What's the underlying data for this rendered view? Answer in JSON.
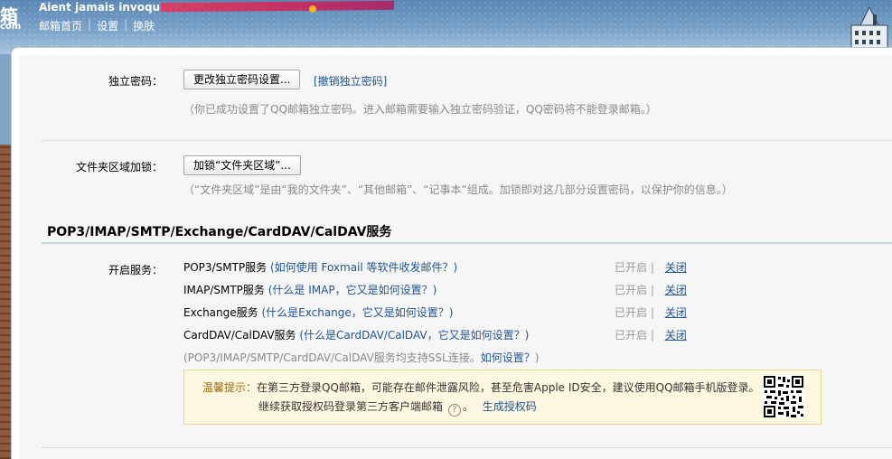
{
  "header": {
    "logo_text": "箱",
    "logo_sub": "com",
    "account_name": "Aient jamais invoqu",
    "links": [
      "邮箱首页",
      "设置",
      "换肤"
    ]
  },
  "independent_password": {
    "label": "独立密码：",
    "change_button": "更改独立密码设置...",
    "revoke_link": "[撤销独立密码]",
    "hint": "（你已成功设置了QQ邮箱独立密码。进入邮箱需要输入独立密码验证，QQ密码将不能登录邮箱。）"
  },
  "folder_lock": {
    "label": "文件夹区域加锁：",
    "lock_button": "加锁“文件夹区域”...",
    "hint": "（“文件夹区域”是由“我的文件夹”、“其他邮箱”、“记事本”组成。加锁即对这几部分设置密码，以保护你的信息。）"
  },
  "services_section": {
    "title": "POP3/IMAP/SMTP/Exchange/CardDAV/CalDAV服务",
    "label": "开启服务：",
    "items": [
      {
        "name": "POP3/SMTP服务",
        "help": "(如何使用 Foxmail 等软件收发邮件？)",
        "status": "已开启",
        "sep": "|",
        "action": "关闭"
      },
      {
        "name": "IMAP/SMTP服务",
        "help": "(什么是 IMAP，它又是如何设置？)",
        "status": "已开启",
        "sep": "|",
        "action": "关闭"
      },
      {
        "name": "Exchange服务",
        "help": "(什么是Exchange，它又是如何设置？)",
        "status": "已开启",
        "sep": "|",
        "action": "关闭"
      },
      {
        "name": "CardDAV/CalDAV服务",
        "help": "(什么是CardDAV/CalDAV，它又是如何设置？)",
        "status": "已开启",
        "sep": "|",
        "action": "关闭"
      }
    ],
    "ssl_note_prefix": "(POP3/IMAP/SMTP/CardDAV/CalDAV服务均支持SSL连接。",
    "ssl_note_link": "如何设置？",
    "ssl_note_suffix": ")"
  },
  "tip": {
    "label": "温馨提示：",
    "line1": "在第三方登录QQ邮箱，可能存在邮件泄露风险，甚至危害Apple ID安全，建议使用QQ邮箱手机版登录。",
    "line2_prefix": "继续获取授权码登录第三方客户端邮箱",
    "help_icon": "?",
    "line2_mid": "。",
    "generate_link": "生成授权码"
  },
  "colors": {
    "link": "#1e5494",
    "tip_bg": "#fff8e0",
    "tip_border": "#efd88c"
  }
}
